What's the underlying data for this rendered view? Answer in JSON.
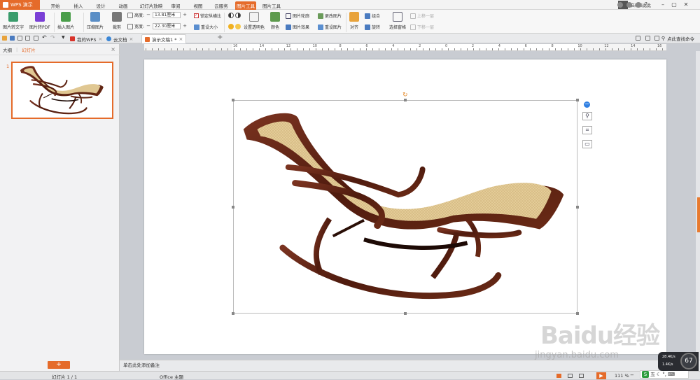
{
  "app": {
    "name": "WPS 演示"
  },
  "menu": {
    "tabs": [
      {
        "label": "开始"
      },
      {
        "label": "插入"
      },
      {
        "label": "设计"
      },
      {
        "label": "动画"
      },
      {
        "label": "幻灯片放映"
      },
      {
        "label": "审阅"
      },
      {
        "label": "视图"
      },
      {
        "label": "云服务"
      },
      {
        "label": "图片工具"
      },
      {
        "label": "图片工具"
      }
    ],
    "active_index": 8,
    "user": "谁来陪此此"
  },
  "ribbon": {
    "to_text": "图片转文字",
    "to_pdf": "图片转PDF",
    "insert_picture": "插入图片",
    "compress": "压缩图片",
    "crop": "裁剪",
    "height_label": "高度:",
    "height_value": "13.81厘米",
    "width_label": "宽度:",
    "width_value": "22.30厘米",
    "lock_ratio": "锁定纵横比",
    "reset_size": "重设大小",
    "transparent": "设置透明色",
    "color": "颜色",
    "outline": "图片轮廓",
    "effect": "图片效果",
    "change": "更改图片",
    "reset_pic": "重设图片",
    "align": "对齐",
    "group": "组合",
    "rotate": "旋转",
    "select_pane": "选择窗格",
    "up_one": "上移一层",
    "down_one": "下移一层"
  },
  "tabs": [
    {
      "label": "我的WPS"
    },
    {
      "label": "云文档"
    },
    {
      "label": "演示文稿1 *"
    }
  ],
  "search_hint": "点此查找命令",
  "left_panel": {
    "outline": "大纲",
    "slides": "幻灯片",
    "slide_number": "1"
  },
  "ruler_numbers": [
    "16",
    "14",
    "12",
    "10",
    "8",
    "6",
    "4",
    "2",
    "0",
    "2",
    "4",
    "6",
    "8",
    "10",
    "12",
    "14",
    "16"
  ],
  "notes_placeholder": "单击此处添加备注",
  "status": {
    "slide": "幻灯片 1 / 1",
    "theme": "Office 主题",
    "zoom": "111 %"
  },
  "perf": {
    "value": "67",
    "up": "28.4K/s",
    "down": "1.4K/s"
  },
  "ime": {
    "label": "五"
  },
  "watermark": {
    "line1": "Baidu经验",
    "line2": "jingyan.baidu.com"
  },
  "colors": {
    "accent": "#e56b2a",
    "chair_wood": "#5a1f10",
    "chair_cane": "#e4cc97"
  }
}
